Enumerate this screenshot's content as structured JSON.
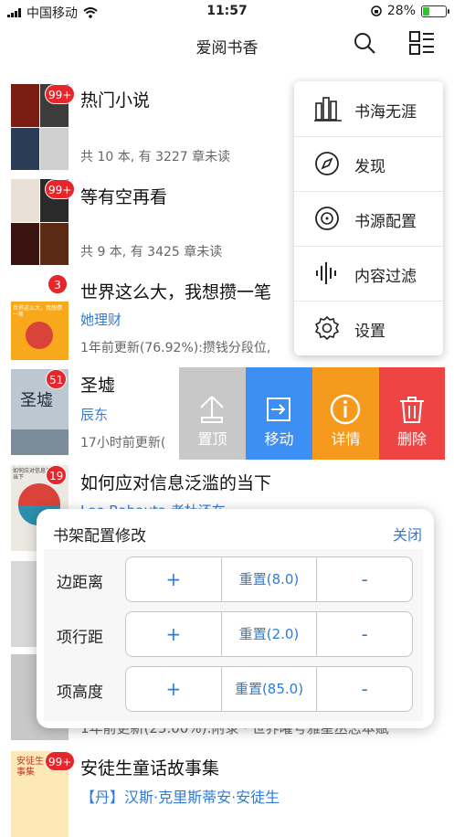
{
  "status": {
    "carrier": "中国移动",
    "time": "11:57",
    "battery": "28%"
  },
  "nav": {
    "title": "爱阅书香",
    "search_icon": "search-icon",
    "menu_icon": "list-menu-icon"
  },
  "books": [
    {
      "title": "热门小说",
      "badge": "99+",
      "info": "共 10 本, 有 3227 章未读"
    },
    {
      "title": "等有空再看",
      "badge": "99+",
      "info": "共 9 本, 有 3425 章未读"
    },
    {
      "title": "世界这么大，我想攒一笔",
      "badge": "3",
      "author": "她理财",
      "info": "1年前更新(76.92%):攒钱分段位,",
      "cover_text": "世界这么大，我想攒一笔"
    },
    {
      "title": "圣墟",
      "badge": "51",
      "author": "辰东",
      "info": "17小时前更新(",
      "cover_text": "圣墟"
    },
    {
      "title": "如何应对信息泛滥的当下",
      "badge": "19",
      "author": "Leo Babauta 老杜还在",
      "cover_text": "如何应对信息泛滥的当下"
    },
    {
      "info": "1年前更新(25.00%):附录 · 世界曜号雅星丛志本赋"
    },
    {
      "title": "安徒生童话故事集",
      "badge": "99+",
      "author": "【丹】汉斯·克里斯蒂安·安徒生",
      "cover_text": "安徒生 故事集"
    }
  ],
  "swipe_actions": {
    "pin": "置顶",
    "move": "移动",
    "detail": "详情",
    "delete": "删除"
  },
  "popup_menu": [
    {
      "label": "书海无涯",
      "icon": "library-books-icon"
    },
    {
      "label": "发现",
      "icon": "compass-icon"
    },
    {
      "label": "书源配置",
      "icon": "disc-icon"
    },
    {
      "label": "内容过滤",
      "icon": "waveform-icon"
    },
    {
      "label": "设置",
      "icon": "gear-icon"
    }
  ],
  "sheet": {
    "title": "书架配置修改",
    "close": "关闭",
    "plus": "+",
    "minus": "-",
    "rows": [
      {
        "label": "边距离",
        "reset": "重置(8.0)"
      },
      {
        "label": "项行距",
        "reset": "重置(2.0)"
      },
      {
        "label": "项高度",
        "reset": "重置(85.0)"
      }
    ]
  }
}
